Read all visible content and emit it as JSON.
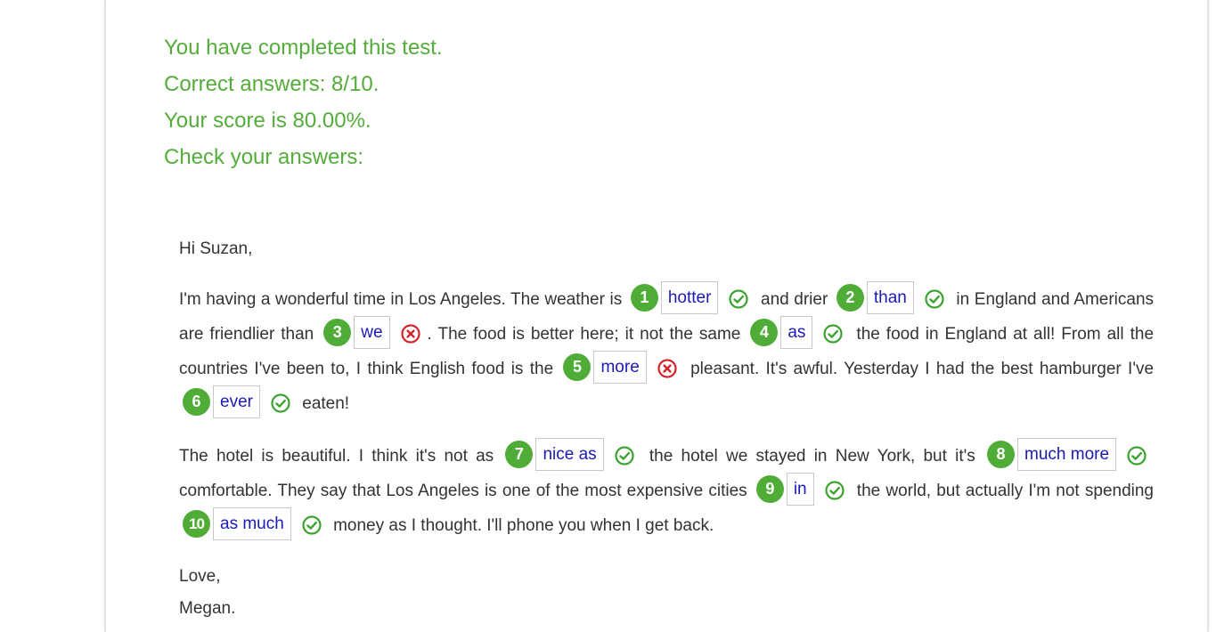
{
  "results": {
    "completed": "You have completed this test.",
    "correct": "Correct answers: 8/10.",
    "score": "Your score is 80.00%.",
    "check": "Check your answers:"
  },
  "letter": {
    "greeting": "Hi Suzan,",
    "p1": {
      "t0": "I'm having a wonderful time in Los Angeles. The weather is",
      "t1": "and drier",
      "t2": "in England and Americans are friendlier than",
      "t3": ". The food is better here; it not the same",
      "t4": "the food in England at all! From all the countries I've been to, I think English food is the",
      "t5": "pleasant. It's awful. Yesterday I had the best hamburger I've",
      "t6": "eaten!"
    },
    "p2": {
      "t0": "The hotel is beautiful. I think it's not as",
      "t1": "the hotel we stayed in New York, but it's",
      "t2": "comfortable. They say that Los Angeles is one of the most expensive cities",
      "t3": "the world, but actually I'm not spending",
      "t4": "money as I thought. I'll phone you when I get back."
    },
    "closing": "Love,",
    "signature": "Megan."
  },
  "answers": [
    {
      "num": "1",
      "value": "hotter",
      "status": "correct"
    },
    {
      "num": "2",
      "value": "than",
      "status": "correct"
    },
    {
      "num": "3",
      "value": "we",
      "status": "incorrect"
    },
    {
      "num": "4",
      "value": "as",
      "status": "correct"
    },
    {
      "num": "5",
      "value": "more",
      "status": "incorrect"
    },
    {
      "num": "6",
      "value": "ever",
      "status": "correct"
    },
    {
      "num": "7",
      "value": "nice as",
      "status": "correct"
    },
    {
      "num": "8",
      "value": "much more",
      "status": "correct"
    },
    {
      "num": "9",
      "value": "in",
      "status": "correct"
    },
    {
      "num": "10",
      "value": "as much",
      "status": "correct"
    }
  ],
  "icons": {
    "correct": "check-circle-icon",
    "incorrect": "x-circle-icon"
  },
  "colors": {
    "result_text": "#54ad3a",
    "badge": "#4fad37",
    "answer_text": "#1a1ab8",
    "correct_mark": "#3aa32f",
    "incorrect_mark": "#d3242b"
  }
}
